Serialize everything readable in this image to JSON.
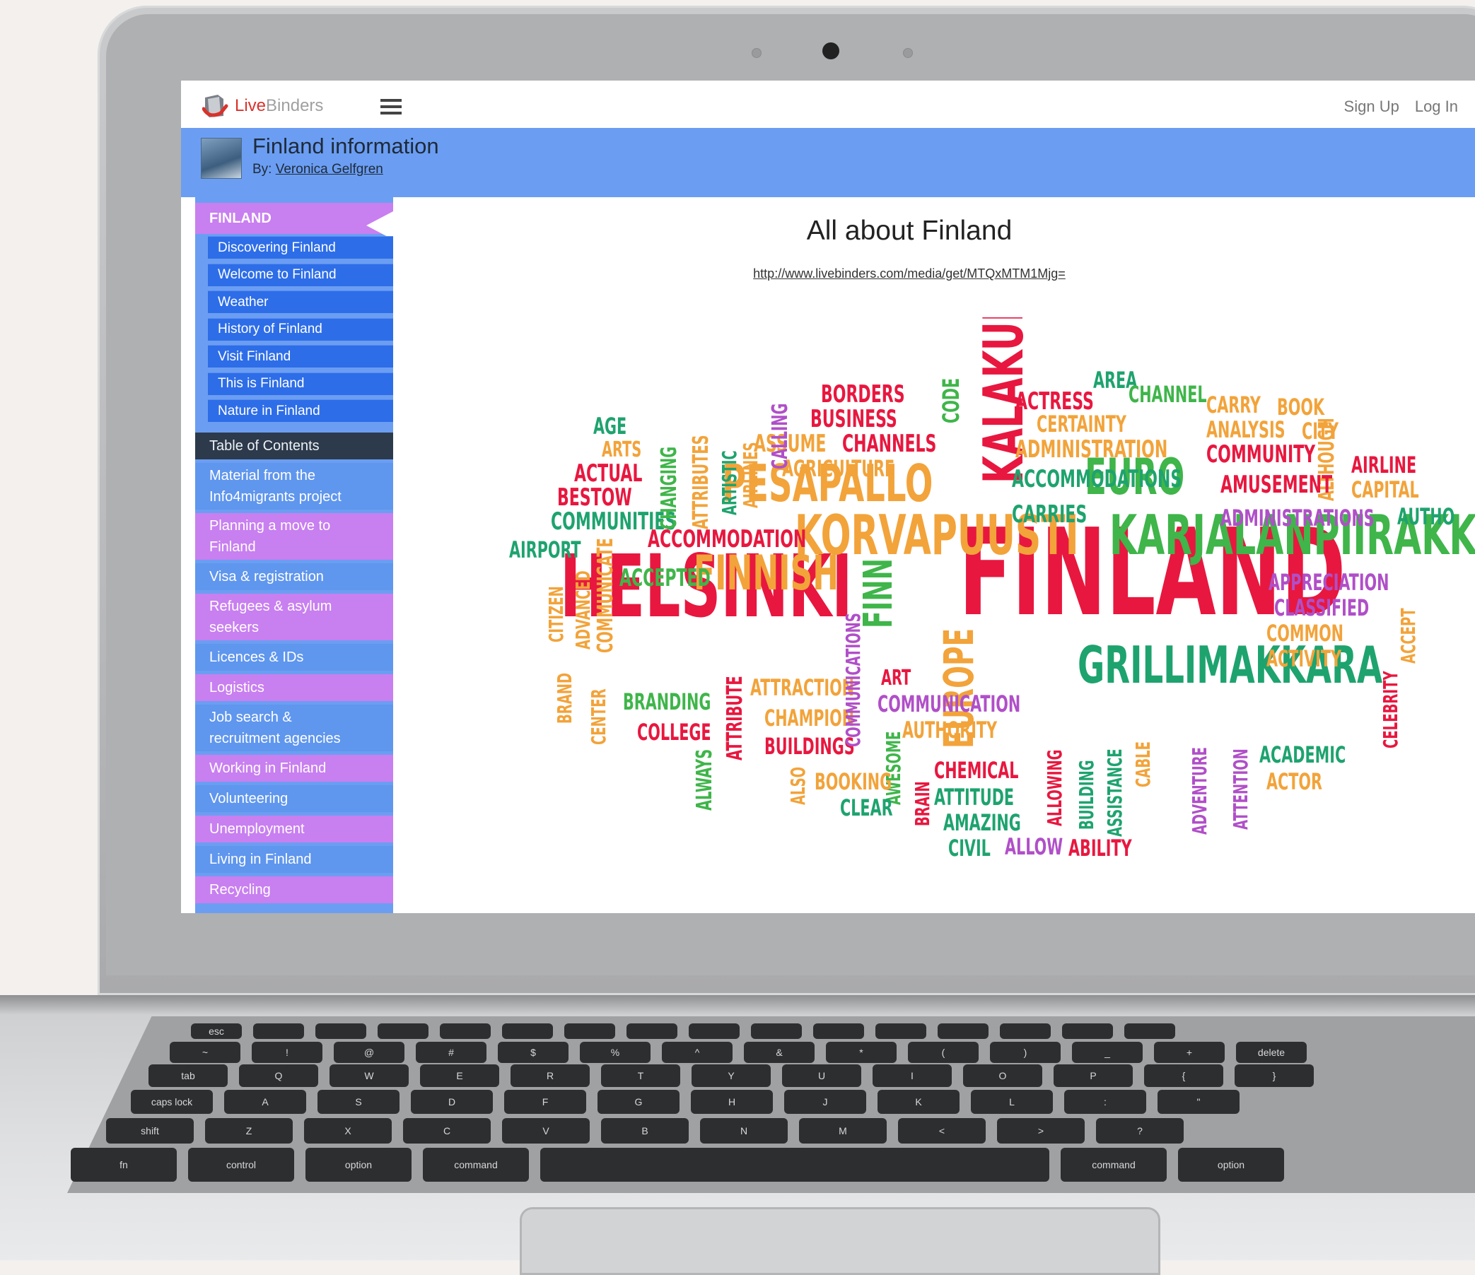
{
  "header": {
    "logo_live": "Live",
    "logo_binders": "Binders",
    "sign_up": "Sign Up",
    "log_in": "Log In",
    "binder_title": "Finland information",
    "by_label": "By:",
    "author": "Veronica Gelfgren"
  },
  "sidebar": {
    "active_tab": "FINLAND",
    "subtabs": [
      "Discovering Finland",
      "Welcome to Finland",
      "Weather",
      "History of Finland",
      "Visit Finland",
      "This is Finland",
      "Nature in Finland"
    ],
    "tabs": [
      {
        "label": "Table of Contents",
        "lines": [
          "Table of Contents"
        ],
        "color": "dark"
      },
      {
        "label": "Material from the Info4migrants project",
        "lines": [
          "Material from the",
          "Info4migrants project"
        ],
        "color": "blue"
      },
      {
        "label": "Planning a move to Finland",
        "lines": [
          "Planning a move to",
          "Finland"
        ],
        "color": "purple"
      },
      {
        "label": "Visa & registration",
        "lines": [
          "Visa & registration"
        ],
        "color": "blue"
      },
      {
        "label": "Refugees & asylum seekers",
        "lines": [
          "Refugees & asylum",
          "seekers"
        ],
        "color": "purple"
      },
      {
        "label": "Licences & IDs",
        "lines": [
          "Licences & IDs"
        ],
        "color": "blue"
      },
      {
        "label": "Logistics",
        "lines": [
          "Logistics"
        ],
        "color": "purple"
      },
      {
        "label": "Job search & recruitment agencies",
        "lines": [
          "Job search &",
          "recruitment agencies"
        ],
        "color": "blue"
      },
      {
        "label": "Working in Finland",
        "lines": [
          "Working in Finland"
        ],
        "color": "purple"
      },
      {
        "label": "Volunteering",
        "lines": [
          "Volunteering"
        ],
        "color": "blue"
      },
      {
        "label": "Unemployment",
        "lines": [
          "Unemployment"
        ],
        "color": "purple"
      },
      {
        "label": "Living in Finland",
        "lines": [
          "Living in Finland"
        ],
        "color": "blue"
      },
      {
        "label": "Recycling",
        "lines": [
          "Recycling"
        ],
        "color": "purple"
      }
    ]
  },
  "content": {
    "title": "All about Finland",
    "link": "http://www.livebinders.com/media/get/MTQxMTM1Mjg=",
    "collapse_glyph": "◂◂◂"
  },
  "word_cloud": [
    {
      "word": "FINLAND",
      "color": "#e8173f"
    },
    {
      "word": "HELSINKI",
      "color": "#e8173f"
    },
    {
      "word": "KORVAPUUSTI",
      "color": "#f2a33a"
    },
    {
      "word": "KARJALANPIIRAKK",
      "color": "#3fb54a"
    },
    {
      "word": "GRILLIMAKKARA",
      "color": "#1ea36e"
    },
    {
      "word": "PESAPALLO",
      "color": "#f2a33a"
    },
    {
      "word": "FINNISH",
      "color": "#f2a33a"
    },
    {
      "word": "KALAKUKKO",
      "color": "#e8173f"
    },
    {
      "word": "EURO",
      "color": "#3fb54a"
    },
    {
      "word": "EUROPE",
      "color": "#f2a33a"
    },
    {
      "word": "FINN",
      "color": "#3fb54a"
    },
    {
      "word": "BORDERS",
      "color": "#e8173f"
    },
    {
      "word": "BUSINESS",
      "color": "#e8173f"
    },
    {
      "word": "CHANNELS",
      "color": "#e8173f"
    },
    {
      "word": "CODE",
      "color": "#3fb54a"
    },
    {
      "word": "ASSUME",
      "color": "#f2a33a"
    },
    {
      "word": "AGRICULTURE",
      "color": "#f2a33a"
    },
    {
      "word": "AREA",
      "color": "#1ea36e"
    },
    {
      "word": "ACTRESS",
      "color": "#e8173f"
    },
    {
      "word": "CHANNEL",
      "color": "#3fb54a"
    },
    {
      "word": "CERTAINTY",
      "color": "#f2a33a"
    },
    {
      "word": "ADMINISTRATION",
      "color": "#f2a33a"
    },
    {
      "word": "CARRY",
      "color": "#f2a33a"
    },
    {
      "word": "BOOK",
      "color": "#f2a33a"
    },
    {
      "word": "ANALYSIS",
      "color": "#f2a33a"
    },
    {
      "word": "CITY",
      "color": "#f2a33a"
    },
    {
      "word": "COMMUNITY",
      "color": "#e8173f"
    },
    {
      "word": "ALTHOUGH",
      "color": "#f2a33a"
    },
    {
      "word": "AIRLINE",
      "color": "#e8173f"
    },
    {
      "word": "CAPITAL",
      "color": "#f2a33a"
    },
    {
      "word": "ACCOMMODATIONS",
      "color": "#1ea36e"
    },
    {
      "word": "AMUSEMENT",
      "color": "#e8173f"
    },
    {
      "word": "CARRIES",
      "color": "#1ea36e"
    },
    {
      "word": "ADMINISTRATIONS",
      "color": "#b04fc8"
    },
    {
      "word": "AUTHO",
      "color": "#1ea36e"
    },
    {
      "word": "AGE",
      "color": "#1ea36e"
    },
    {
      "word": "ARTS",
      "color": "#f2a33a"
    },
    {
      "word": "ACTUAL",
      "color": "#e8173f"
    },
    {
      "word": "BESTOW",
      "color": "#e8173f"
    },
    {
      "word": "COMMUNITIES",
      "color": "#1ea36e"
    },
    {
      "word": "CHANGING",
      "color": "#3fb54a"
    },
    {
      "word": "ATTRIBUTES",
      "color": "#f2a33a"
    },
    {
      "word": "ARTISTIC",
      "color": "#1ea36e"
    },
    {
      "word": "AIRLINES",
      "color": "#f2a33a"
    },
    {
      "word": "CALLING",
      "color": "#b04fc8"
    },
    {
      "word": "AIRPORT",
      "color": "#1ea36e"
    },
    {
      "word": "COMMUNICATE",
      "color": "#f2a33a"
    },
    {
      "word": "ACCOMMODATION",
      "color": "#e8173f"
    },
    {
      "word": "ACCEPTED",
      "color": "#3fb54a"
    },
    {
      "word": "CITIZEN",
      "color": "#f2a33a"
    },
    {
      "word": "ADVANCED",
      "color": "#f2a33a"
    },
    {
      "word": "BRAND",
      "color": "#f2a33a"
    },
    {
      "word": "CENTER",
      "color": "#f2a33a"
    },
    {
      "word": "BRANDING",
      "color": "#3fb54a"
    },
    {
      "word": "COLLEGE",
      "color": "#e8173f"
    },
    {
      "word": "ATTRIBUTE",
      "color": "#e8173f"
    },
    {
      "word": "ALWAYS",
      "color": "#3fb54a"
    },
    {
      "word": "ATTRACTION",
      "color": "#f2a33a"
    },
    {
      "word": "CHAMPION",
      "color": "#f2a33a"
    },
    {
      "word": "BUILDINGS",
      "color": "#e8173f"
    },
    {
      "word": "COMMUNICATIONS",
      "color": "#b04fc8"
    },
    {
      "word": "ART",
      "color": "#e8173f"
    },
    {
      "word": "COMMUNICATION",
      "color": "#b04fc8"
    },
    {
      "word": "AUTHORITY",
      "color": "#f2a33a"
    },
    {
      "word": "AWESOME",
      "color": "#3fb54a"
    },
    {
      "word": "ALSO",
      "color": "#f2a33a"
    },
    {
      "word": "BOOKING",
      "color": "#f2a33a"
    },
    {
      "word": "CLEAR",
      "color": "#1ea36e"
    },
    {
      "word": "BRAIN",
      "color": "#e8173f"
    },
    {
      "word": "CHEMICAL",
      "color": "#e8173f"
    },
    {
      "word": "ATTITUDE",
      "color": "#1ea36e"
    },
    {
      "word": "AMAZING",
      "color": "#1ea36e"
    },
    {
      "word": "CIVIL",
      "color": "#1ea36e"
    },
    {
      "word": "ALLOW",
      "color": "#b04fc8"
    },
    {
      "word": "ABILITY",
      "color": "#e8173f"
    },
    {
      "word": "ALLOWING",
      "color": "#e8173f"
    },
    {
      "word": "BUILDING",
      "color": "#1ea36e"
    },
    {
      "word": "ASSISTANCE",
      "color": "#1ea36e"
    },
    {
      "word": "CABLE",
      "color": "#f2a33a"
    },
    {
      "word": "ADVENTURE",
      "color": "#b04fc8"
    },
    {
      "word": "ATTENTION",
      "color": "#b04fc8"
    },
    {
      "word": "ACADEMIC",
      "color": "#1ea36e"
    },
    {
      "word": "ACTOR",
      "color": "#f2a33a"
    },
    {
      "word": "APPRECIATION",
      "color": "#b04fc8"
    },
    {
      "word": "CLASSIFIED",
      "color": "#b04fc8"
    },
    {
      "word": "COMMON",
      "color": "#f2a33a"
    },
    {
      "word": "ACTIVITY",
      "color": "#f2a33a"
    },
    {
      "word": "CELEBRITY",
      "color": "#e8173f"
    },
    {
      "word": "ACCEPT",
      "color": "#f2a33a"
    }
  ],
  "keyboard": {
    "row1": [
      "esc",
      "",
      "",
      "",
      "",
      "",
      "",
      "",
      "",
      "",
      "",
      "",
      "",
      "",
      "",
      ""
    ],
    "row2": [
      "~",
      "!",
      "@",
      "#",
      "$",
      "%",
      "^",
      "&",
      "*",
      "(",
      ")",
      "_",
      "+",
      "delete"
    ],
    "row3": [
      "tab",
      "Q",
      "W",
      "E",
      "R",
      "T",
      "Y",
      "U",
      "I",
      "O",
      "P",
      "{",
      "}"
    ],
    "row4": [
      "caps lock",
      "A",
      "S",
      "D",
      "F",
      "G",
      "H",
      "J",
      "K",
      "L",
      ":",
      "\""
    ],
    "row5": [
      "shift",
      "Z",
      "X",
      "C",
      "V",
      "B",
      "N",
      "M",
      "<",
      ">",
      "?"
    ],
    "row6": [
      "fn",
      "control",
      "option",
      "command",
      "",
      "command",
      "option"
    ]
  }
}
